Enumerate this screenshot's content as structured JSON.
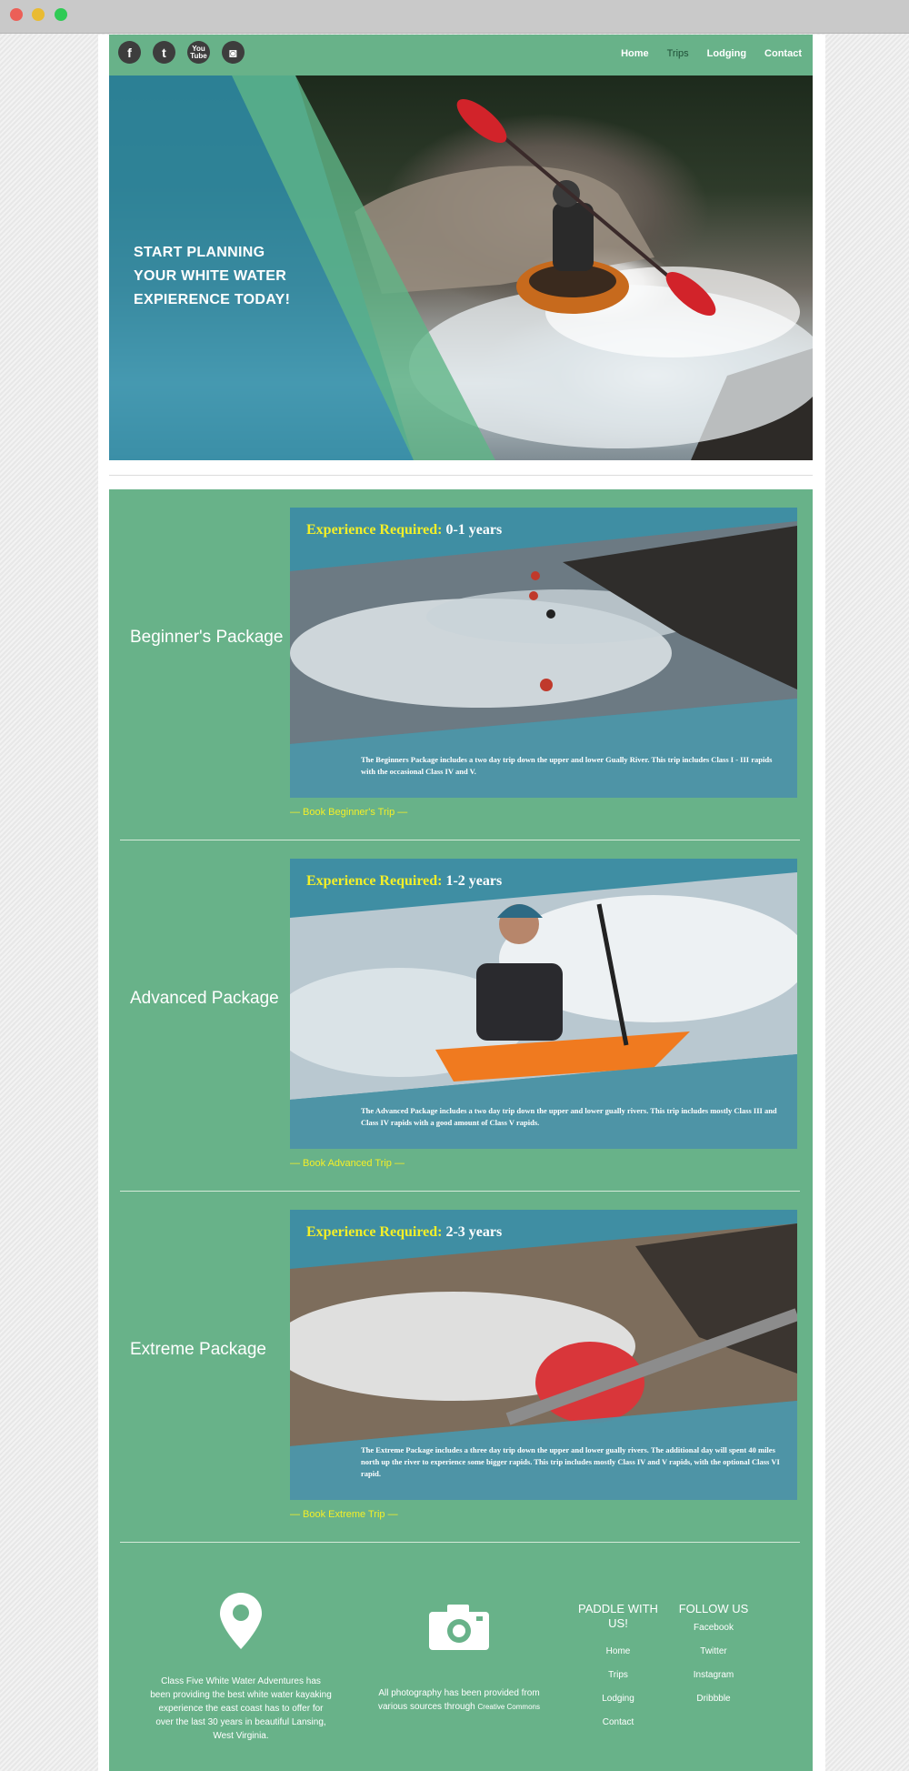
{
  "colors": {
    "brand_green": "#68b289",
    "overlay_blue": "#2f8faa",
    "accent_yellow": "#f3ef28",
    "icon_dark": "#3d3d3d"
  },
  "header": {
    "social": [
      {
        "icon": "facebook-icon",
        "glyph": "f"
      },
      {
        "icon": "twitter-icon",
        "glyph": "t"
      },
      {
        "icon": "youtube-icon",
        "glyph": "You Tube"
      },
      {
        "icon": "instagram-icon",
        "glyph": "◙"
      }
    ],
    "nav": [
      "Home",
      "Trips",
      "Lodging",
      "Contact"
    ],
    "active_nav": "Trips"
  },
  "hero": {
    "headline": "START PLANNING YOUR WHITE WATER EXPIERENCE TODAY!"
  },
  "packages": [
    {
      "title": "Beginner's Package",
      "exp_label": "Experience Required:",
      "exp_years": "0-1 years",
      "description": "The Beginners Package includes a two day trip down the upper and lower Gually River. This trip includes Class I - III rapids with the occasional Class IV and V.",
      "link": "— Book Beginner's Trip —"
    },
    {
      "title": "Advanced Package",
      "exp_label": "Experience Required:",
      "exp_years": "1-2 years",
      "description": "The Advanced Package includes a two day trip down the upper and lower gually rivers. This trip includes mostly Class III and Class IV rapids with a good amount of Class V rapids.",
      "link": "— Book Advanced Trip —"
    },
    {
      "title": "Extreme Package",
      "exp_label": "Experience Required:",
      "exp_years": "2-3 years",
      "description": "The Extreme Package includes a three day trip down the upper and lower gually rivers. The additional day will spent 40 miles north up the river to experience some bigger rapids. This trip includes mostly Class IV and V rapids, with the optional Class VI rapid.",
      "link": "— Book Extreme Trip —"
    }
  ],
  "footer": {
    "about": "Class Five White Water Adventures has been providing the best white water kayaking experience the east coast has to offer for over the last 30 years in beautiful Lansing, West Virginia.",
    "photo_credit": "All photography has been provided from various sources through",
    "photo_credit_link": "Creative Commons",
    "paddle_heading": "PADDLE WITH US!",
    "paddle_links": [
      "Home",
      "Trips",
      "Lodging",
      "Contact"
    ],
    "follow_heading": "FOLLOW US",
    "follow_links": [
      "Facebook",
      "Twitter",
      "Instagram",
      "Dribbble"
    ]
  }
}
